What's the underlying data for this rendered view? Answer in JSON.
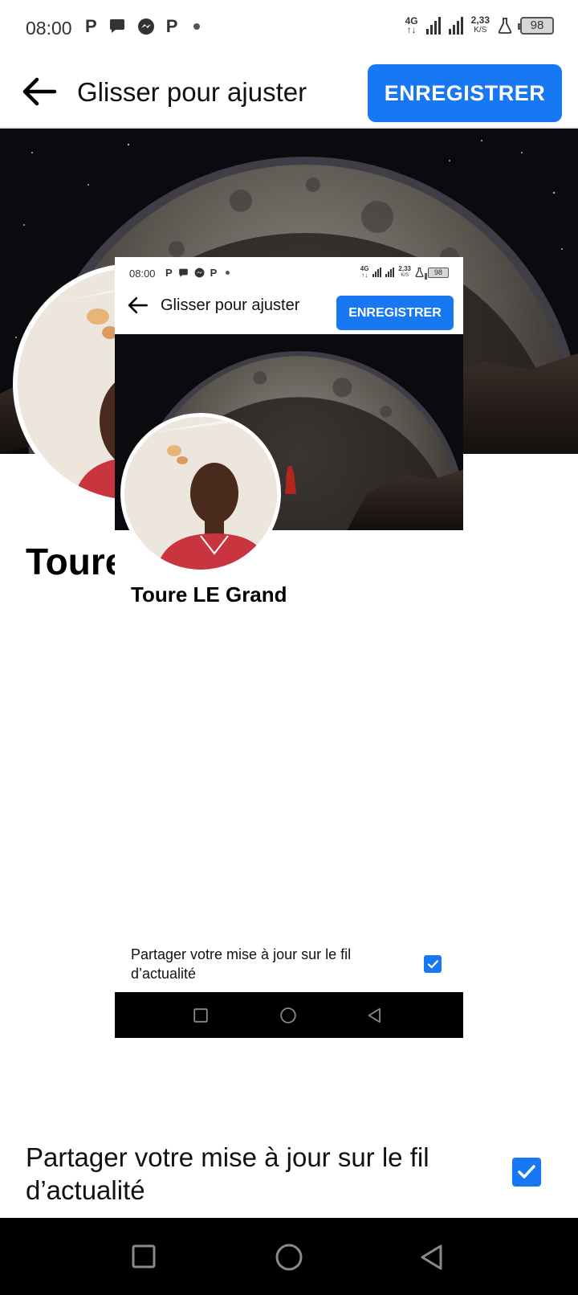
{
  "status_bar": {
    "time": "08:00",
    "notif_icons": [
      "p-icon",
      "chat-bubble-icon",
      "messenger-icon",
      "p-icon"
    ],
    "network": "4G",
    "speed_value": "2,33",
    "speed_unit": "K/S",
    "battery": "98"
  },
  "header": {
    "title": "Glisser pour ajuster",
    "save_label": "ENREGISTRER"
  },
  "profile": {
    "name_visible": "Toure",
    "name": "Toure LE Grand"
  },
  "share": {
    "label": "Partager votre mise à jour sur le fil d’actualité",
    "checked": true
  },
  "nav": {
    "icons": [
      "recent-apps-icon",
      "home-icon",
      "back-icon"
    ]
  },
  "colors": {
    "accent": "#1877f2",
    "navbar": "#000000"
  }
}
